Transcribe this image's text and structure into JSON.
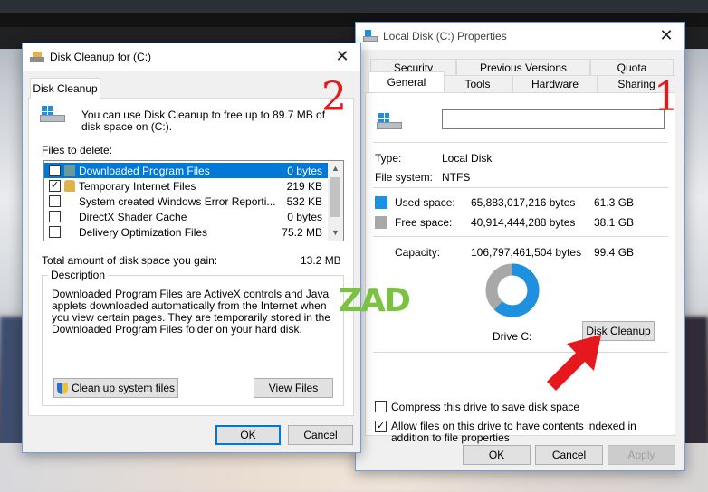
{
  "colors": {
    "accent": "#0078d7",
    "used_space": "#1e90e0",
    "free_space": "#a8a8a8",
    "annotation_red": "#e5181e"
  },
  "cleanup": {
    "title": "Disk Cleanup for  (C:)",
    "tab": "Disk Cleanup",
    "intro": "You can use Disk Cleanup to free up to 89.7 MB of disk space on  (C:).",
    "files_label": "Files to delete:",
    "items": [
      {
        "name": "Downloaded Program Files",
        "size": "0 bytes",
        "checked": true
      },
      {
        "name": "Temporary Internet Files",
        "size": "219 KB",
        "checked": true
      },
      {
        "name": "System created Windows Error Reporti...",
        "size": "532 KB",
        "checked": false
      },
      {
        "name": "DirectX Shader Cache",
        "size": "0 bytes",
        "checked": false
      },
      {
        "name": "Delivery Optimization Files",
        "size": "75.2 MB",
        "checked": false
      }
    ],
    "total_label": "Total amount of disk space you gain:",
    "total_value": "13.2 MB",
    "description_label": "Description",
    "description": "Downloaded Program Files are ActiveX controls and Java applets downloaded automatically from the Internet when you view certain pages. They are temporarily stored in the Downloaded Program Files folder on your hard disk.",
    "clean_system_button": "Clean up system files",
    "view_files_button": "View Files",
    "ok": "OK",
    "cancel": "Cancel"
  },
  "props": {
    "title": "Local Disk (C:) Properties",
    "tabs_row1": [
      "Security",
      "Previous Versions",
      "Quota"
    ],
    "tabs_row2": [
      "General",
      "Tools",
      "Hardware",
      "Sharing"
    ],
    "name_value": "",
    "type_label": "Type:",
    "type_value": "Local Disk",
    "fs_label": "File system:",
    "fs_value": "NTFS",
    "used_label": "Used space:",
    "used_bytes": "65,883,017,216 bytes",
    "used_gb": "61.3 GB",
    "free_label": "Free space:",
    "free_bytes": "40,914,444,288 bytes",
    "free_gb": "38.1 GB",
    "cap_label": "Capacity:",
    "cap_bytes": "106,797,461,504 bytes",
    "cap_gb": "99.4 GB",
    "used_fraction": 0.617,
    "drive_label": "Drive C:",
    "disk_cleanup_button": "Disk Cleanup",
    "compress_label": "Compress this drive to save disk space",
    "compress_checked": false,
    "index_label": "Allow files on this drive to have contents indexed in addition to file properties",
    "index_checked": true,
    "ok": "OK",
    "cancel": "Cancel",
    "apply": "Apply"
  },
  "annotations": {
    "one": "1",
    "two": "2",
    "watermark": "ZAD"
  }
}
